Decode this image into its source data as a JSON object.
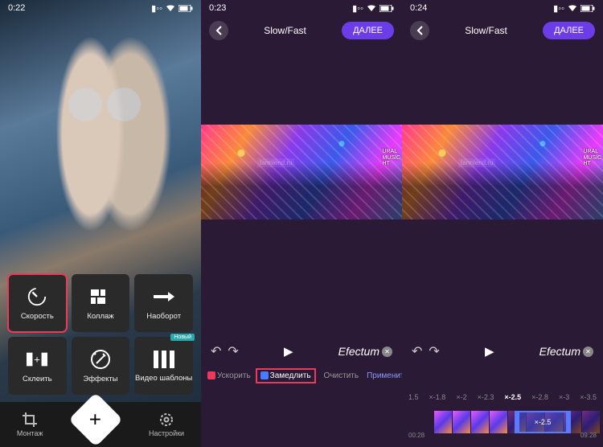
{
  "phone1": {
    "time": "0:22",
    "tiles": [
      {
        "label": "Скорость",
        "icon": "speed"
      },
      {
        "label": "Коллаж",
        "icon": "collage"
      },
      {
        "label": "Наоборот",
        "icon": "reverse"
      },
      {
        "label": "Склеить",
        "icon": "merge"
      },
      {
        "label": "Эффекты",
        "icon": "effects"
      },
      {
        "label": "Видео шаблоны",
        "icon": "templates",
        "badge": "Новый"
      }
    ],
    "nav": {
      "montage": "Монтаж",
      "settings": "Настройки"
    }
  },
  "phone2": {
    "time": "0:23",
    "title": "Slow/Fast",
    "next": "ДАЛЕЕ",
    "brand": "Efectum",
    "actions": {
      "speedup": "Ускорить",
      "slowdown": "Замедлить",
      "clear": "Очистить",
      "apply": "Применить"
    },
    "watermark": "farmlend.ru",
    "sidetext": "URAL\nMUSIC\nHT"
  },
  "phone3": {
    "time": "0:24",
    "title": "Slow/Fast",
    "next": "ДАЛЕЕ",
    "brand": "Efectum",
    "speeds": [
      "1.5",
      "×-1.8",
      "×-2",
      "×-2.3",
      "×-2.5",
      "×-2.8",
      "×-3",
      "×-3.5"
    ],
    "active_speed": "×-2.5",
    "segment_label": "×-2.5",
    "tl_start": "00:28",
    "tl_end": "09:28",
    "watermark": "farmlend.ru",
    "sidetext": "URAL\nMUSIC\nHT"
  }
}
